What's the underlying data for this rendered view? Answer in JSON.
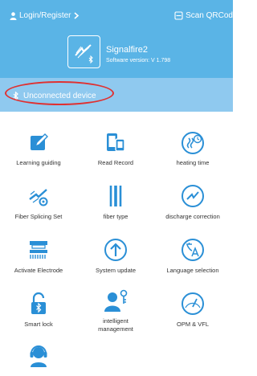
{
  "header": {
    "login_label": "Login/Register",
    "scan_label": "Scan QRCod",
    "app_name": "Signalfire2",
    "software_version": "Software version: V 1.798"
  },
  "status": {
    "connection_text": "Unconnected device"
  },
  "menu": {
    "items": [
      {
        "label": "Learning guiding",
        "icon": "edit-icon"
      },
      {
        "label": "Read Record",
        "icon": "devices-icon"
      },
      {
        "label": "heating time",
        "icon": "heat-timer-icon"
      },
      {
        "label": "Fiber Splicing Set",
        "icon": "splice-settings-icon"
      },
      {
        "label": "fiber type",
        "icon": "fiber-icon"
      },
      {
        "label": "discharge correction",
        "icon": "discharge-icon"
      },
      {
        "label": "Activate Electrode",
        "icon": "electrode-icon"
      },
      {
        "label": "System update",
        "icon": "update-icon"
      },
      {
        "label": "Language selection",
        "icon": "language-icon"
      },
      {
        "label": "Smart lock",
        "icon": "lock-icon"
      },
      {
        "label": "intelligent management",
        "label_line1": "intelligent",
        "label_line2": "management",
        "icon": "user-key-icon"
      },
      {
        "label": "OPM & VFL",
        "icon": "gauge-icon"
      },
      {
        "label": "",
        "icon": "support-icon"
      }
    ]
  },
  "colors": {
    "header": "#5ab4e6",
    "status_bar": "#8fc9ef",
    "icon": "#2a8fd6",
    "highlight_ring": "#e03030"
  }
}
